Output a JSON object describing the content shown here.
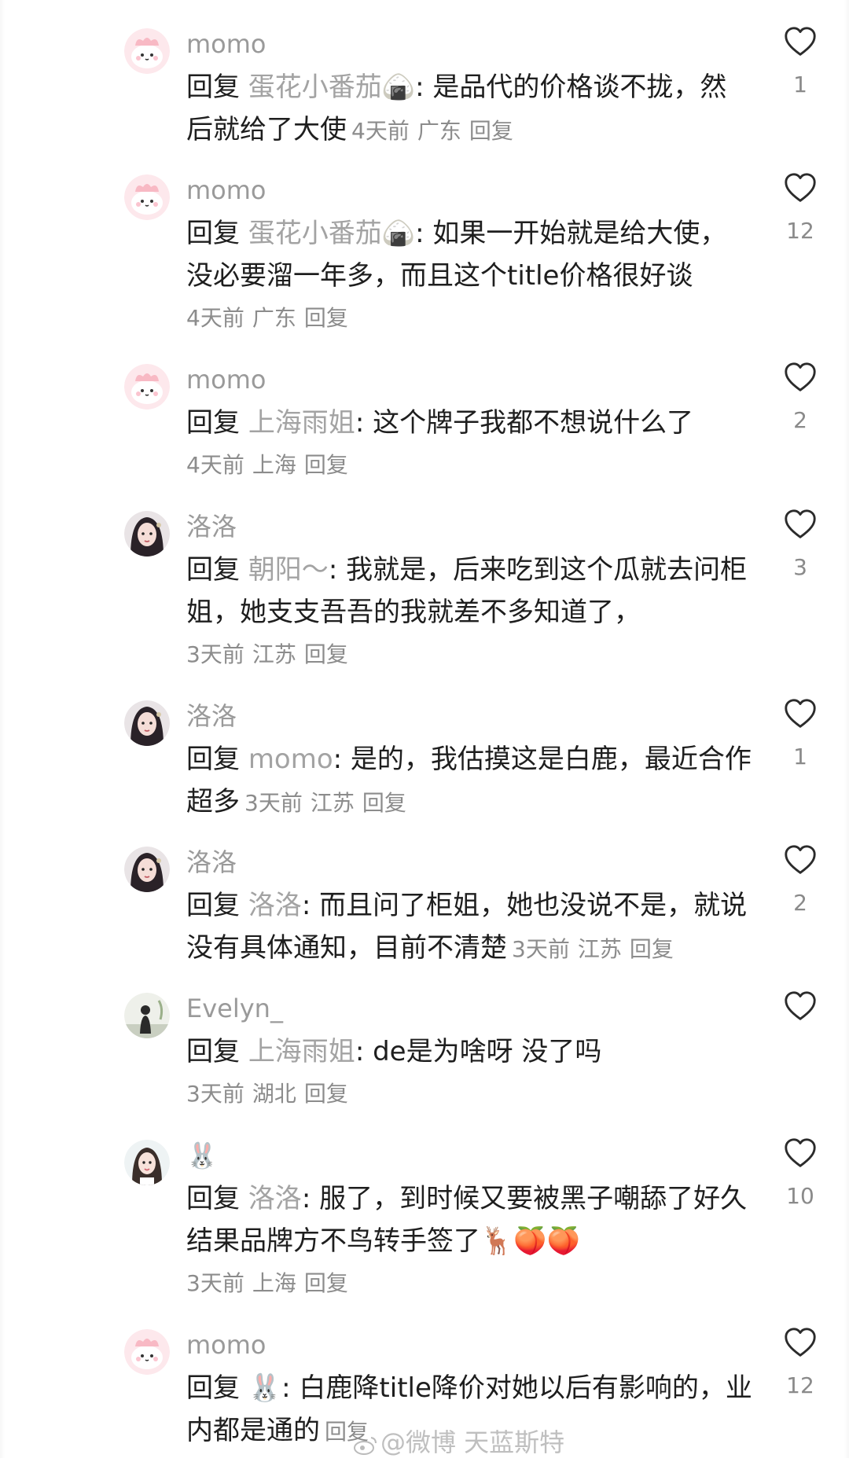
{
  "comments": [
    {
      "username": "momo",
      "reply_word": "回复",
      "target": "蛋花小番茄🍙",
      "colon": ":",
      "text": " 是品代的价格谈不拢，然后就给了大使",
      "time": "4天前",
      "location": "广东",
      "reply_label": "回复",
      "likes": "1",
      "avatar": "pink-bunny-avatar"
    },
    {
      "username": "momo",
      "reply_word": "回复",
      "target": "蛋花小番茄🍙",
      "colon": ":",
      "text": " 如果一开始就是给大使，没必要溜一年多，而且这个title价格很好谈",
      "time": "4天前",
      "location": "广东",
      "reply_label": "回复",
      "likes": "12",
      "avatar": "pink-bunny-avatar"
    },
    {
      "username": "momo",
      "reply_word": "回复",
      "target": "上海雨姐",
      "colon": ":",
      "text": " 这个牌子我都不想说什么了",
      "time": "4天前",
      "location": "上海",
      "reply_label": "回复",
      "likes": "2",
      "avatar": "pink-bunny-avatar"
    },
    {
      "username": "洛洛",
      "reply_word": "回复",
      "target": "朝阳～",
      "colon": ":",
      "text": " 我就是，后来吃到这个瓜就去问柜姐，她支支吾吾的我就差不多知道了，",
      "time": "3天前",
      "location": "江苏",
      "reply_label": "回复",
      "likes": "3",
      "avatar": "woman-portrait-avatar"
    },
    {
      "username": "洛洛",
      "reply_word": "回复",
      "target": "momo",
      "colon": ":",
      "text": " 是的，我估摸这是白鹿，最近合作超多",
      "time": "3天前",
      "location": "江苏",
      "reply_label": "回复",
      "likes": "1",
      "avatar": "woman-portrait-avatar"
    },
    {
      "username": "洛洛",
      "reply_word": "回复",
      "target": "洛洛",
      "colon": ":",
      "text": " 而且问了柜姐，她也没说不是，就说没有具体通知，目前不清楚",
      "time": "3天前",
      "location": "江苏",
      "reply_label": "回复",
      "likes": "2",
      "avatar": "woman-portrait-avatar"
    },
    {
      "username": "Evelyn_",
      "reply_word": "回复",
      "target": "上海雨姐",
      "colon": ":",
      "text": " de是为啥呀 没了吗",
      "time": "3天前",
      "location": "湖北",
      "reply_label": "回复",
      "likes": "",
      "avatar": "silhouette-photo-avatar"
    },
    {
      "username": "🐰",
      "reply_word": "回复",
      "target": "洛洛",
      "colon": ":",
      "text": " 服了，到时候又要被黑子嘲舔了好久结果品牌方不鸟转手签了🦌🍑🍑",
      "time": "3天前",
      "location": "上海",
      "reply_label": "回复",
      "likes": "10",
      "avatar": "girl-portrait-avatar"
    },
    {
      "username": "momo",
      "reply_word": "回复",
      "target": "🐰",
      "colon": ":",
      "text": " 白鹿降title降价对她以后有影响的，业内都是通的",
      "time": "",
      "location": "",
      "reply_label": "回复",
      "likes": "12",
      "avatar": "pink-bunny-avatar"
    }
  ],
  "watermark": "@微博 天蓝斯特",
  "colors": {
    "text": "#1e1e1e",
    "muted": "#8c8c8c",
    "username": "#9a9a9a",
    "heart": "#2b2b2b",
    "bunny_avatar_bg": "#fde8ec"
  }
}
